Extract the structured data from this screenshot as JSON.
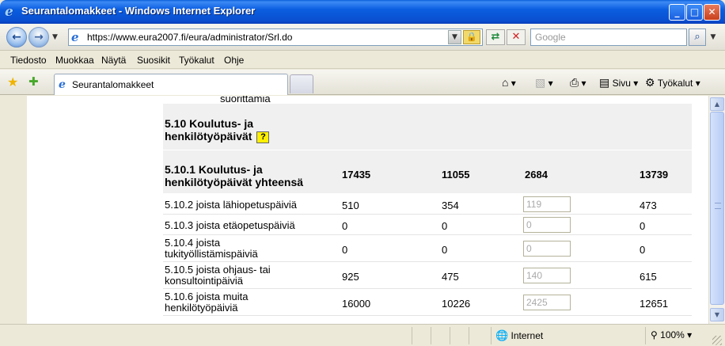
{
  "window": {
    "title": "Seurantalomakkeet - Windows Internet Explorer",
    "minimize_label": "_",
    "maximize_label": "□",
    "close_label": "✕"
  },
  "address": {
    "url": "https://www.eura2007.fi/eura/administrator/Srl.do",
    "search_placeholder": "Google"
  },
  "menu": [
    "Tiedosto",
    "Muokkaa",
    "Näytä",
    "Suosikit",
    "Työkalut",
    "Ohje"
  ],
  "tab": {
    "label": "Seurantalomakkeet"
  },
  "commands": {
    "page": "Sivu",
    "tools": "Työkalut"
  },
  "content": {
    "cut_text": "suorittamia",
    "section": {
      "label_line1": "5.10 Koulutus- ja",
      "label_line2": "henkilötyöpäivät",
      "help": "?"
    },
    "total": {
      "label_line1": "5.10.1 Koulutus- ja",
      "label_line2": "henkilötyöpäivät yhteensä",
      "values": [
        "17435",
        "11055",
        "2684",
        "13739"
      ]
    },
    "rows": [
      {
        "line1": "5.10.2 joista lähiopetuspäiviä",
        "line2": "",
        "v1": "510",
        "v2": "354",
        "input": "119",
        "v4": "473"
      },
      {
        "line1": "5.10.3 joista etäopetuspäiviä",
        "line2": "",
        "v1": "0",
        "v2": "0",
        "input": "0",
        "v4": "0"
      },
      {
        "line1": "5.10.4 joista",
        "line2": "tukityöllistämispäiviä",
        "v1": "0",
        "v2": "0",
        "input": "0",
        "v4": "0"
      },
      {
        "line1": "5.10.5 joista ohjaus- tai",
        "line2": "konsultointipäiviä",
        "v1": "925",
        "v2": "475",
        "input": "140",
        "v4": "615"
      },
      {
        "line1": "5.10.6 joista muita",
        "line2": "henkilötyöpäiviä",
        "v1": "16000",
        "v2": "10226",
        "input": "2425",
        "v4": "12651"
      }
    ]
  },
  "status": {
    "zone": "Internet",
    "zoom": "100%"
  },
  "icons": {
    "ie": "ie-logo-icon",
    "back": "back-arrow-icon",
    "forward": "forward-arrow-icon",
    "lock": "lock-icon",
    "refresh": "refresh-icon",
    "stop": "stop-icon",
    "search": "search-icon",
    "favorites": "favorites-star-icon",
    "add_favorite": "add-favorite-icon",
    "home": "home-icon",
    "feeds": "feeds-icon",
    "print": "print-icon",
    "page": "page-icon",
    "tools": "gear-icon",
    "globe": "globe-icon",
    "zoom": "zoom-icon"
  }
}
